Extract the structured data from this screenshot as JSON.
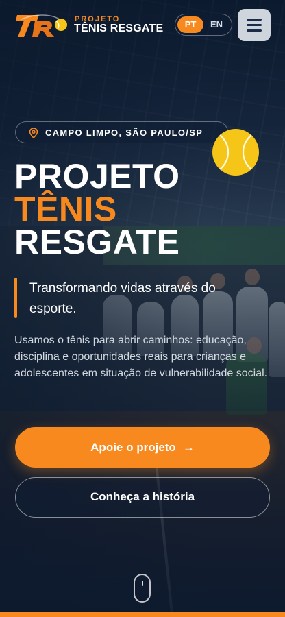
{
  "header": {
    "brand_kicker": "PROJETO",
    "brand_name": "TÊNIS RESGATE",
    "lang_options": {
      "pt": "PT",
      "en": "EN"
    },
    "active_lang": "PT",
    "menu_icon": "hamburger-menu-icon"
  },
  "hero": {
    "location": "CAMPO LIMPO, SÃO PAULO/SP",
    "location_icon": "map-pin-icon",
    "title_lines": [
      "PROJETO",
      "TÊNIS",
      "RESGATE"
    ],
    "tagline": "Transformando vidas através do esporte.",
    "description": "Usamos o tênis para abrir caminhos: educação, disciplina e oportunidades reais para crianças e adolescentes em situação de vulnerabilidade social.",
    "primary_cta": "Apoie o projeto",
    "primary_cta_icon": "arrow-right-icon",
    "secondary_cta": "Conheça a história",
    "scroll_icon": "scroll-mouse-icon"
  },
  "colors": {
    "accent": "#f7891f",
    "navy": "#0f1f36",
    "ball": "#f5c518"
  }
}
